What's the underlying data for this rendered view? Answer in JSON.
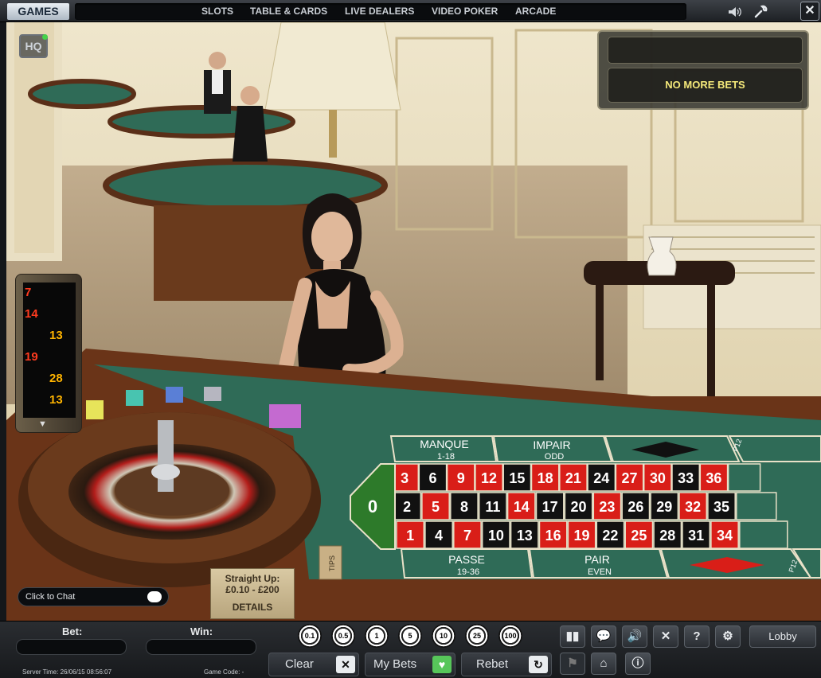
{
  "nav": {
    "games_tab": "GAMES",
    "items": [
      "SLOTS",
      "TABLE & CARDS",
      "LIVE DEALERS",
      "VIDEO POKER",
      "ARCADE"
    ],
    "icons": [
      "speaker-icon",
      "wrench-icon",
      "close-icon"
    ],
    "close_label": "✕"
  },
  "scene": {
    "logo": "HQ",
    "status_message": "NO MORE BETS",
    "history": [
      {
        "num": "7",
        "color": "#ff3b1f"
      },
      {
        "num": "14",
        "color": "#ff3b1f"
      },
      {
        "num": "13",
        "color": "#ffb400"
      },
      {
        "num": "19",
        "color": "#ff3b1f"
      },
      {
        "num": "28",
        "color": "#ffb400"
      },
      {
        "num": "13",
        "color": "#ffb400"
      }
    ],
    "history_arrow": "▼",
    "chat_placeholder": "Click to Chat",
    "limits": {
      "line1": "Straight Up:",
      "line2": "£0.10 - £200",
      "details": "DETAILS"
    },
    "tips_label": "TIPS"
  },
  "table": {
    "outside": {
      "manque": "MANQUE",
      "manque_sub": "1-18",
      "impair": "IMPAIR",
      "impair_sub": "ODD",
      "passe": "PASSE",
      "passe_sub": "19-36",
      "pair": "PAIR",
      "pair_sub": "EVEN",
      "col_top": "P12",
      "col_bottom": "P12",
      "zero": "0"
    },
    "rows": [
      [
        {
          "n": "3",
          "c": "r"
        },
        {
          "n": "6",
          "c": "b"
        },
        {
          "n": "9",
          "c": "r"
        },
        {
          "n": "12",
          "c": "r"
        },
        {
          "n": "15",
          "c": "b"
        },
        {
          "n": "18",
          "c": "r"
        },
        {
          "n": "21",
          "c": "r"
        },
        {
          "n": "24",
          "c": "b"
        },
        {
          "n": "27",
          "c": "r"
        },
        {
          "n": "30",
          "c": "r"
        },
        {
          "n": "33",
          "c": "b"
        },
        {
          "n": "36",
          "c": "r"
        }
      ],
      [
        {
          "n": "2",
          "c": "b"
        },
        {
          "n": "5",
          "c": "r"
        },
        {
          "n": "8",
          "c": "b"
        },
        {
          "n": "11",
          "c": "b"
        },
        {
          "n": "14",
          "c": "r"
        },
        {
          "n": "17",
          "c": "b"
        },
        {
          "n": "20",
          "c": "b"
        },
        {
          "n": "23",
          "c": "r"
        },
        {
          "n": "26",
          "c": "b"
        },
        {
          "n": "29",
          "c": "b"
        },
        {
          "n": "32",
          "c": "r"
        },
        {
          "n": "35",
          "c": "b"
        }
      ],
      [
        {
          "n": "1",
          "c": "r"
        },
        {
          "n": "4",
          "c": "b"
        },
        {
          "n": "7",
          "c": "r"
        },
        {
          "n": "10",
          "c": "b"
        },
        {
          "n": "13",
          "c": "b"
        },
        {
          "n": "16",
          "c": "r"
        },
        {
          "n": "19",
          "c": "r"
        },
        {
          "n": "22",
          "c": "b"
        },
        {
          "n": "25",
          "c": "r"
        },
        {
          "n": "28",
          "c": "b"
        },
        {
          "n": "31",
          "c": "b"
        },
        {
          "n": "34",
          "c": "r"
        }
      ]
    ],
    "colors": {
      "red": "#d91e18",
      "black": "#111111",
      "felt": "#2f6b57",
      "zero": "#2d7a2a"
    }
  },
  "bottom": {
    "bet_label": "Bet:",
    "win_label": "Win:",
    "server_time": "Server Time: 26/06/15 08:56:07",
    "game_code": "Game Code: -",
    "chips": [
      "0.1",
      "0.5",
      "1",
      "5",
      "10",
      "25",
      "100"
    ],
    "clear": "Clear",
    "my_bets": "My Bets",
    "rebet": "Rebet",
    "lobby": "Lobby"
  }
}
